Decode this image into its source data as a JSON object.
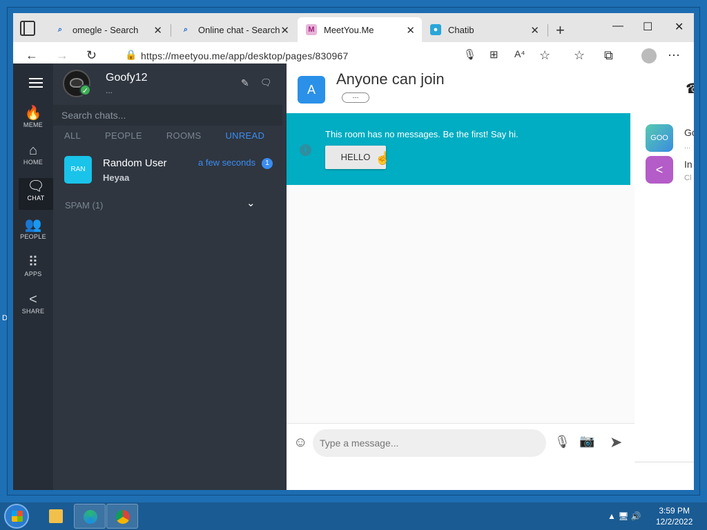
{
  "browser": {
    "tabs": [
      {
        "label": "omegle - Search",
        "favicon": "search-icon"
      },
      {
        "label": "Online chat - Search",
        "favicon": "search-icon"
      },
      {
        "label": "MeetYou.Me",
        "favicon": "meetyou-icon"
      },
      {
        "label": "Chatib",
        "favicon": "chatib-icon"
      }
    ],
    "url": "https://meetyou.me/app/desktop/pages/830967"
  },
  "rail": {
    "items": [
      {
        "label": "MEME",
        "icon": "flame-icon"
      },
      {
        "label": "HOME",
        "icon": "home-icon"
      },
      {
        "label": "CHAT",
        "icon": "chat-icon"
      },
      {
        "label": "PEOPLE",
        "icon": "people-icon"
      },
      {
        "label": "APPS",
        "icon": "apps-icon"
      },
      {
        "label": "SHARE",
        "icon": "share-icon"
      }
    ]
  },
  "profile": {
    "name": "Goofy12",
    "status": "..."
  },
  "chat_list": {
    "search_placeholder": "Search chats...",
    "filters": [
      "ALL",
      "PEOPLE",
      "ROOMS",
      "UNREAD"
    ],
    "active_filter": "UNREAD",
    "chats": [
      {
        "avatar_text": "RAN",
        "name": "Random User",
        "preview": "Heyaa",
        "time": "a few seconds",
        "unread": "1"
      }
    ],
    "spam_label": "SPAM (1)"
  },
  "room": {
    "avatar_text": "A",
    "title": "Anyone can join",
    "pill": "---",
    "notice": "This room has no messages. Be the first! Say hi.",
    "hello_label": "HELLO",
    "composer_placeholder": "Type a message..."
  },
  "side_list": [
    {
      "avatar_text": "GOO",
      "name": "Go",
      "sub": "..."
    },
    {
      "avatar_text": "",
      "name": "In",
      "sub": "Cl"
    }
  ],
  "desktop": {
    "label": "D"
  },
  "taskbar": {
    "time": "3:59 PM",
    "date": "12/2/2022"
  },
  "colors": {
    "accent": "#3b8df0",
    "notice": "#00adc2",
    "rail": "#272d36",
    "panel": "#2f3640"
  }
}
